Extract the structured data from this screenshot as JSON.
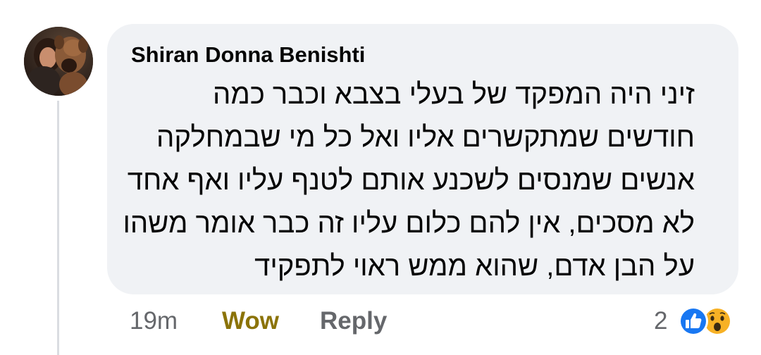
{
  "comment": {
    "author": "Shiran Donna Benishti",
    "lines": [
      "זיני היה המפקד של בעלי בצבא וכבר כמה",
      "חודשים שמתקשרים אליו ואל כל מי שבמחלקה",
      "אנשים שמנסים לשכנע אותם לטנף עליו ואף אחד",
      "לא מסכים, אין להם כלום עליו זה כבר אומר משהו",
      "על הבן אדם, שהוא ממש ראוי לתפקיד"
    ]
  },
  "actions": {
    "time": "19m",
    "reaction_label": "Wow",
    "reply_label": "Reply"
  },
  "reactions": {
    "count": "2",
    "icons": [
      "like-icon",
      "wow-icon"
    ],
    "colors": {
      "like": "#1877f2",
      "wow": "#f7b125",
      "wow_label": "#8b7308"
    }
  }
}
